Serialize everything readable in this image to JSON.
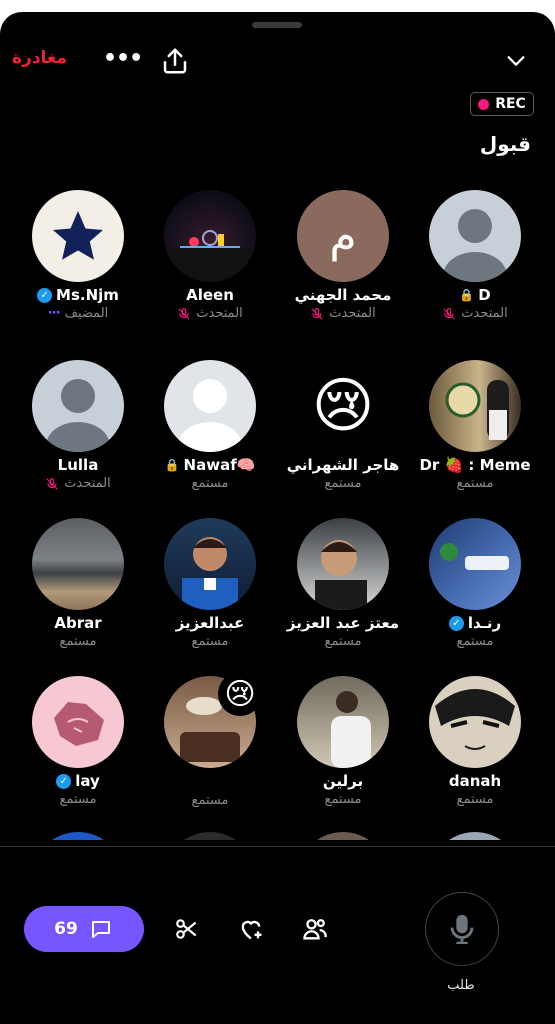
{
  "header": {
    "leave_label": "مغادرة",
    "more_label": "•••",
    "rec_label": "REC"
  },
  "section": {
    "title": "قبول"
  },
  "participants": [
    {
      "name": "D",
      "role": "المتحدث",
      "badge": "lock",
      "muted": true
    },
    {
      "name": "محمد الجهني",
      "role": "المتحدث",
      "muted": true
    },
    {
      "name": "Aleen",
      "role": "المتحدث",
      "muted": true
    },
    {
      "name": "Ms.Njm",
      "role": "المضيف",
      "badge": "verified",
      "host": true
    },
    {
      "name": "Dr 🍓 : Meme",
      "role": "مستمع"
    },
    {
      "name": "هاجر الشهراني",
      "role": "مستمع",
      "avatar_emoji": "😢"
    },
    {
      "name": "Nawaf🧠",
      "role": "مستمع",
      "badge": "lock"
    },
    {
      "name": "Lulla",
      "role": "المتحدث",
      "muted": true
    },
    {
      "name": "رنـدا",
      "role": "مستمع",
      "badge": "verified"
    },
    {
      "name": "معتز عبد العزيز",
      "role": "مستمع"
    },
    {
      "name": "عبدالعزيز",
      "role": "مستمع"
    },
    {
      "name": "Abrar",
      "role": "مستمع"
    },
    {
      "name": "danah",
      "role": "مستمع"
    },
    {
      "name": "برلين",
      "role": "مستمع"
    },
    {
      "name": "",
      "role": "مستمع",
      "reaction_emoji": "😢"
    },
    {
      "name": "lay",
      "role": "مستمع",
      "badge": "verified"
    }
  ],
  "footer": {
    "chat_count": "69",
    "request_label": "طلب"
  },
  "colors": {
    "accent": "#7856ff",
    "leave": "#f4212e",
    "rec_dot": "#f91880",
    "verified": "#1d9bf0",
    "muted_icon": "#f91880"
  }
}
